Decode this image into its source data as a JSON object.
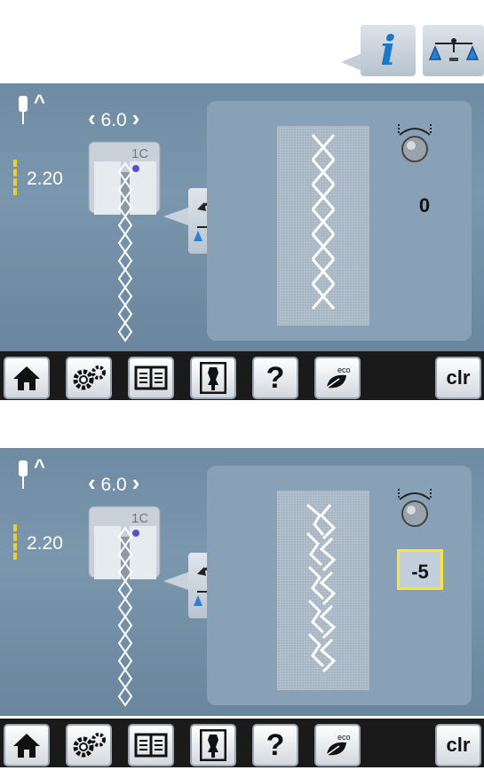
{
  "toolbar": {
    "info_icon": "info-icon",
    "info_glyph": "i",
    "balance_icon": "balance-icon"
  },
  "screens": [
    {
      "stitch_width": "6.0",
      "stitch_length": "2.20",
      "foot_label": "1C",
      "balance_value": "0",
      "balance_highlighted": false
    },
    {
      "stitch_width": "6.0",
      "stitch_length": "2.20",
      "foot_label": "1C",
      "balance_value": "-5",
      "balance_highlighted": true
    }
  ],
  "bottom_bar": {
    "home_icon": "home-icon",
    "settings_icon": "settings-icon",
    "tutorial_icon": "book-icon",
    "consultant_icon": "dress-form-icon",
    "help_label": "?",
    "eco_icon": "eco-icon",
    "clr_label": "clr"
  },
  "colors": {
    "screen_bg": "#7b97ae",
    "length_marker": "#f2ce2a",
    "highlight_frame": "#ffe23a",
    "info_blue": "#1b78c8"
  }
}
